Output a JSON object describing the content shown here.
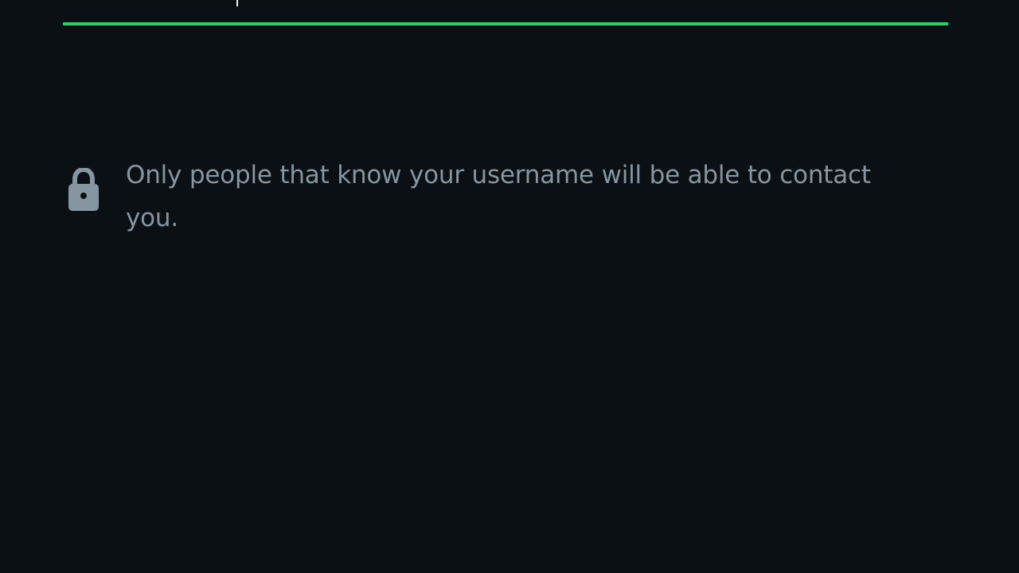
{
  "username_field": {
    "value": "",
    "accent_color": "#25d366"
  },
  "privacy_notice": {
    "icon": "lock-icon",
    "text": "Only people that know your username will be able to contact you."
  },
  "colors": {
    "background": "#0b1014",
    "secondary_text": "#8696a0",
    "primary_text": "#e9edef"
  }
}
